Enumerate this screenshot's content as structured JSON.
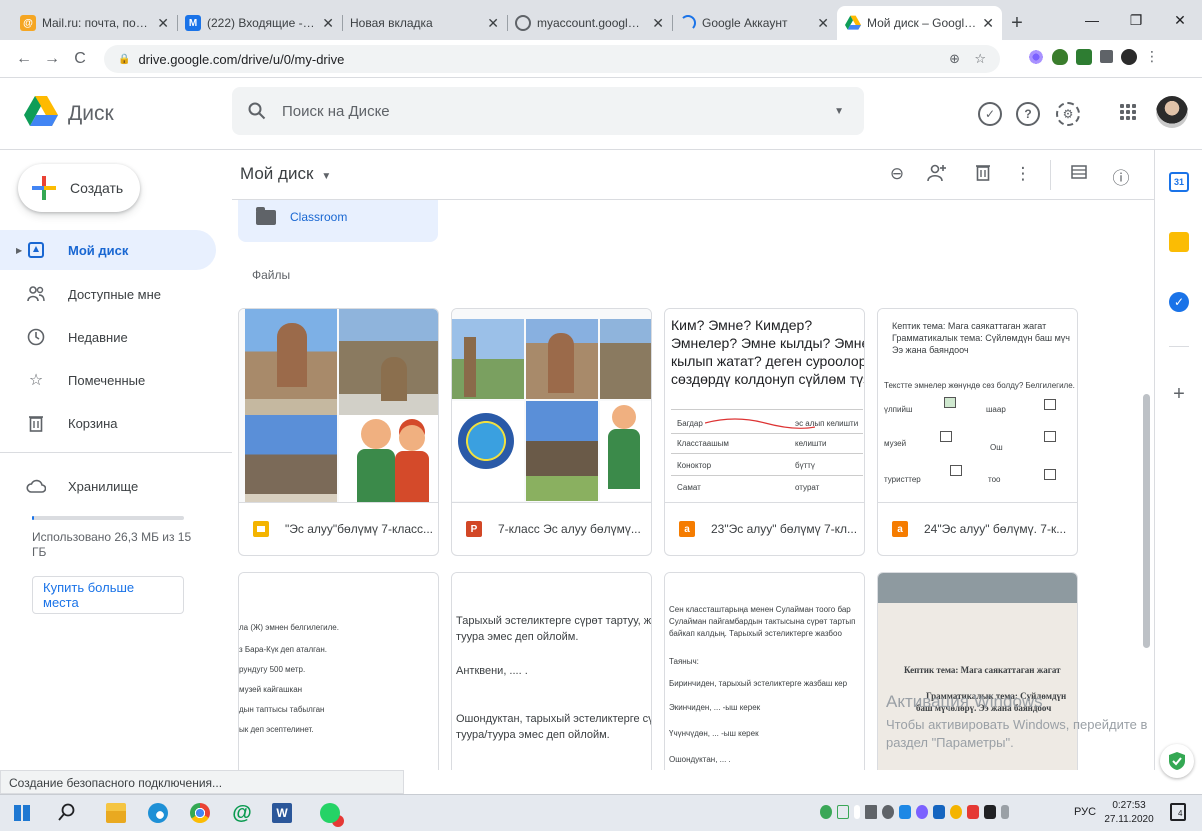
{
  "browser": {
    "tabs": [
      {
        "title": "Mail.ru: почта, поиск в",
        "color": "#f5a623",
        "glyph": "@",
        "active": false
      },
      {
        "title": "(222) Входящие - Почт",
        "color": "#1a73e8",
        "glyph": "M",
        "active": false
      },
      {
        "title": "Новая вкладка",
        "color": "",
        "glyph": "",
        "active": false
      },
      {
        "title": "myaccount.google.com",
        "color": "#5f6368",
        "glyph": "",
        "active": false
      },
      {
        "title": "Google Аккаунт",
        "color": "#1a73e8",
        "glyph": "",
        "active": false
      },
      {
        "title": "Мой диск – Google Ди",
        "color": "#0f9d58",
        "glyph": "",
        "active": true
      }
    ],
    "url": "drive.google.com/drive/u/0/my-drive",
    "status": "Создание безопасного подключения..."
  },
  "header": {
    "brand": "Диск",
    "search_placeholder": "Поиск на Диске"
  },
  "sidebar": {
    "create_label": "Создать",
    "items": [
      {
        "label": "Мой диск",
        "icon": "my-drive-icon",
        "selected": true
      },
      {
        "label": "Доступные мне",
        "icon": "shared-with-me-icon",
        "selected": false
      },
      {
        "label": "Недавние",
        "icon": "recent-clock-icon",
        "selected": false
      },
      {
        "label": "Помеченные",
        "icon": "star-icon",
        "selected": false
      },
      {
        "label": "Корзина",
        "icon": "trash-icon",
        "selected": false
      }
    ],
    "storage_label": "Хранилище",
    "quota_text": "Использовано 26,3 МБ из 15 ГБ",
    "quota_used_fraction": 0.0017,
    "buy_label": "Купить больше места"
  },
  "main": {
    "title": "Мой диск",
    "folder_name": "Classroom",
    "files_section": "Файлы",
    "files": [
      {
        "name": "\"Эс алуу\"бөлүмү 7-класс...",
        "type": "slides",
        "color": "#f4b400"
      },
      {
        "name": "7-класс Эс алуу бөлүмү...",
        "type": "powerpoint",
        "color": "#d24726",
        "glyph": "P"
      },
      {
        "name": "23\"Эс алуу\" бөлүмү 7-кл...",
        "type": "pdf-orange",
        "color": "#f57c00",
        "glyph": "a"
      },
      {
        "name": "24\"Эс алуу\" бөлүмү. 7-к...",
        "type": "pdf-orange",
        "color": "#f57c00",
        "glyph": "a"
      }
    ],
    "doc3": {
      "lines": [
        "Ким? Эмне? Кимдер?",
        "Эмнелер? Эмне кылды? Эмне",
        "кылып жатат? деген суроолор",
        "сөздөрдү колдонуп сүйлөм түз"
      ],
      "table": [
        [
          "Багдар",
          "эс алып келишти"
        ],
        [
          "Класстаашым",
          "келишти"
        ],
        [
          "Коноктор",
          "бүттү"
        ],
        [
          "Самат",
          "отурат"
        ]
      ]
    },
    "doc4": {
      "lines": [
        "Кептик тема: Мага саякаттаган жагат",
        "Грамматикалык тема: Сүйлөмдүн баш мүч",
        "Ээ жана баяндооч"
      ],
      "question": "Текстте эмнелер жөнүндө сөз болду? Белгилегиле.",
      "options": [
        [
          "үлпийш",
          "шаар"
        ],
        [
          "музей",
          "Ош"
        ],
        [
          "туристтер",
          "тоо"
        ]
      ]
    },
    "doc5": {
      "lines": [
        "ла (Ж) эмнен белгилегиле.",
        "з Бара-Күк деп аталган.",
        "рундугу 500 метр.",
        "музей кайгашкан",
        "дын таптысы табылган",
        "ык деп эсептелинет."
      ]
    },
    "doc6": {
      "lines": [
        "Тарыхый эстеликтерге сүрөт тартуу, ж",
        "туура эмес деп ойлойм.",
        "Антквени, .... .",
        "Ошондуктан, тарыхый эстеликтерге сү",
        "туура/туура эмес деп ойлойм."
      ]
    },
    "doc7": {
      "lines": [
        "Сен классташтарыңа менен Сулайман тоого бар",
        "Сулайман пайгамбардын тактысына сүрөт тартып",
        "байкап калдың. Тарыхый эстеликтерге жазбоо",
        "Таяныч:",
        "Биринчиден, тарыхый эстеликтерге жазбаш кер",
        "Экинчиден, ... -ыш керек",
        "Үчүнчүдөн, ... -ыш керек",
        "Ошондуктан, ... ."
      ]
    },
    "doc8": {
      "lines": [
        "Кептик тема: Мага саякаттаган жагат",
        "Грамматикалык тема: Сүйлөмдүн",
        "баш мүчөлөрү. Ээ жана баяндооч"
      ]
    }
  },
  "watermark": {
    "title": "Активация Windows",
    "body": "Чтобы активировать Windows, перейдите в раздел \"Параметры\"."
  },
  "taskbar": {
    "lang": "РУС",
    "time": "0:27:53",
    "date": "27.11.2020",
    "notifications": "4"
  }
}
